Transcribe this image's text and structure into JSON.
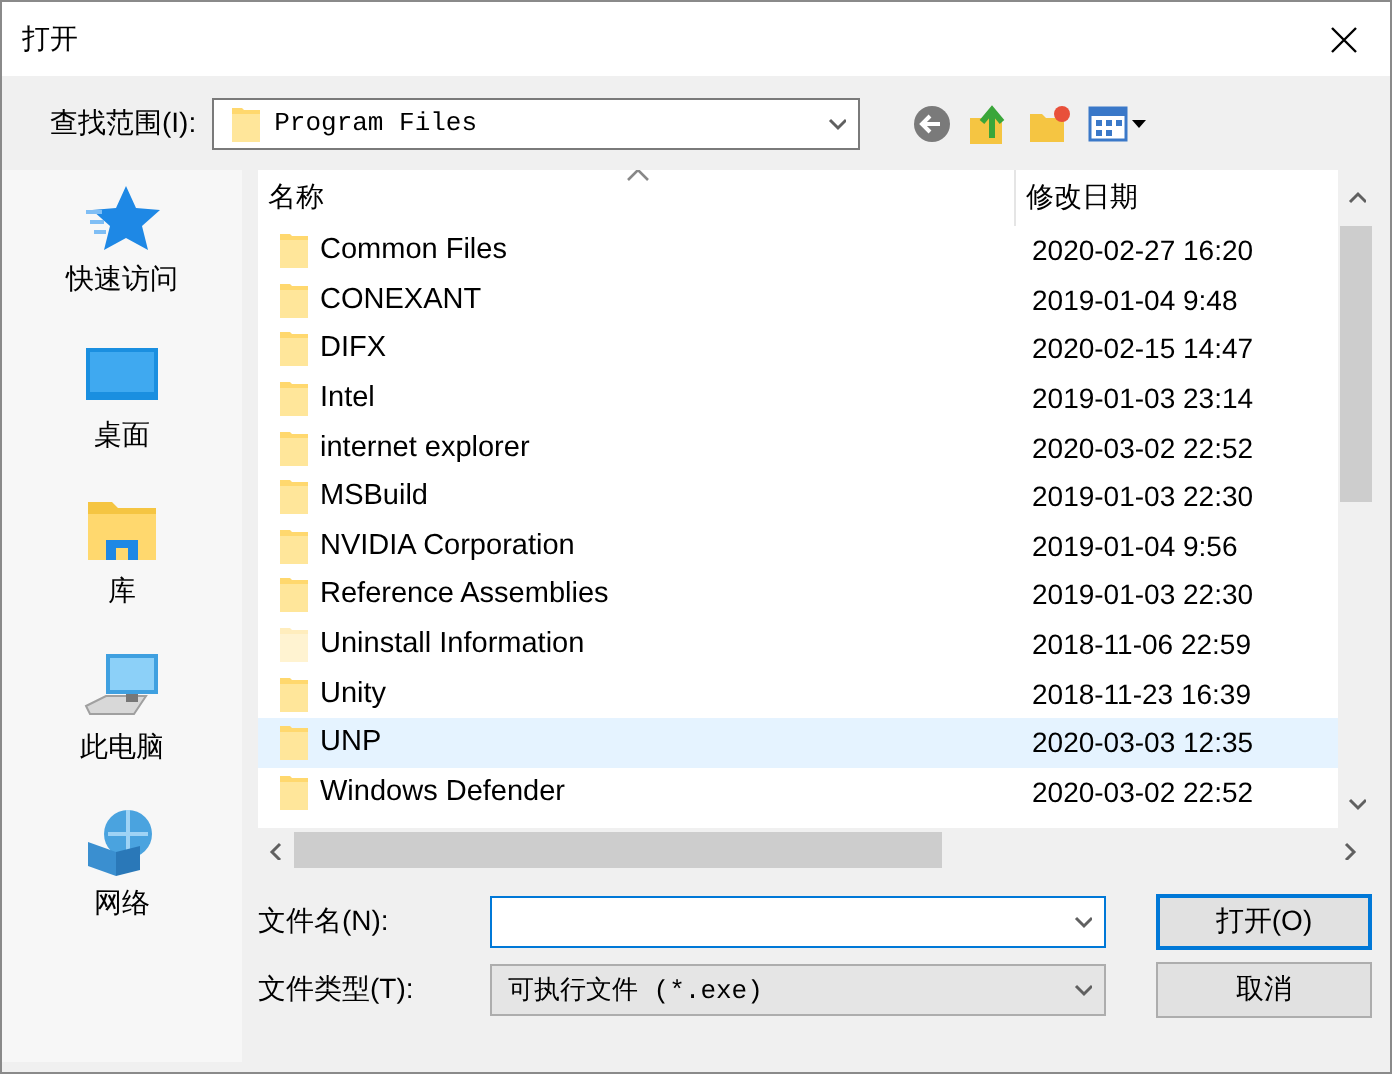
{
  "window": {
    "title": "打开"
  },
  "look_in": {
    "label": "查找范围(I):",
    "value": "Program Files"
  },
  "places": [
    {
      "label": "快速访问",
      "kind": "quick"
    },
    {
      "label": "桌面",
      "kind": "desktop"
    },
    {
      "label": "库",
      "kind": "library"
    },
    {
      "label": "此电脑",
      "kind": "computer"
    },
    {
      "label": "网络",
      "kind": "network"
    }
  ],
  "file_list": {
    "columns": [
      "名称",
      "修改日期"
    ],
    "rows": [
      {
        "name": "Common Files",
        "modified": "2020-02-27 16:20",
        "selected": false,
        "hidden": false
      },
      {
        "name": "CONEXANT",
        "modified": "2019-01-04 9:48",
        "selected": false,
        "hidden": false
      },
      {
        "name": "DIFX",
        "modified": "2020-02-15 14:47",
        "selected": false,
        "hidden": false
      },
      {
        "name": "Intel",
        "modified": "2019-01-03 23:14",
        "selected": false,
        "hidden": false
      },
      {
        "name": "internet explorer",
        "modified": "2020-03-02 22:52",
        "selected": false,
        "hidden": false
      },
      {
        "name": "MSBuild",
        "modified": "2019-01-03 22:30",
        "selected": false,
        "hidden": false
      },
      {
        "name": "NVIDIA Corporation",
        "modified": "2019-01-04 9:56",
        "selected": false,
        "hidden": false
      },
      {
        "name": "Reference Assemblies",
        "modified": "2019-01-03 22:30",
        "selected": false,
        "hidden": false
      },
      {
        "name": "Uninstall Information",
        "modified": "2018-11-06 22:59",
        "selected": false,
        "hidden": true
      },
      {
        "name": "Unity",
        "modified": "2018-11-23 16:39",
        "selected": false,
        "hidden": false
      },
      {
        "name": "UNP",
        "modified": "2020-03-03 12:35",
        "selected": true,
        "hidden": false
      },
      {
        "name": "Windows Defender",
        "modified": "2020-03-02 22:52",
        "selected": false,
        "hidden": false
      }
    ]
  },
  "file_name": {
    "label": "文件名(N):"
  },
  "file_type": {
    "label": "文件类型(T):",
    "value": "可执行文件 (*.exe)"
  },
  "buttons": [
    {
      "label": "打开(O)",
      "default": true
    },
    {
      "label": "取消",
      "default": false
    }
  ]
}
